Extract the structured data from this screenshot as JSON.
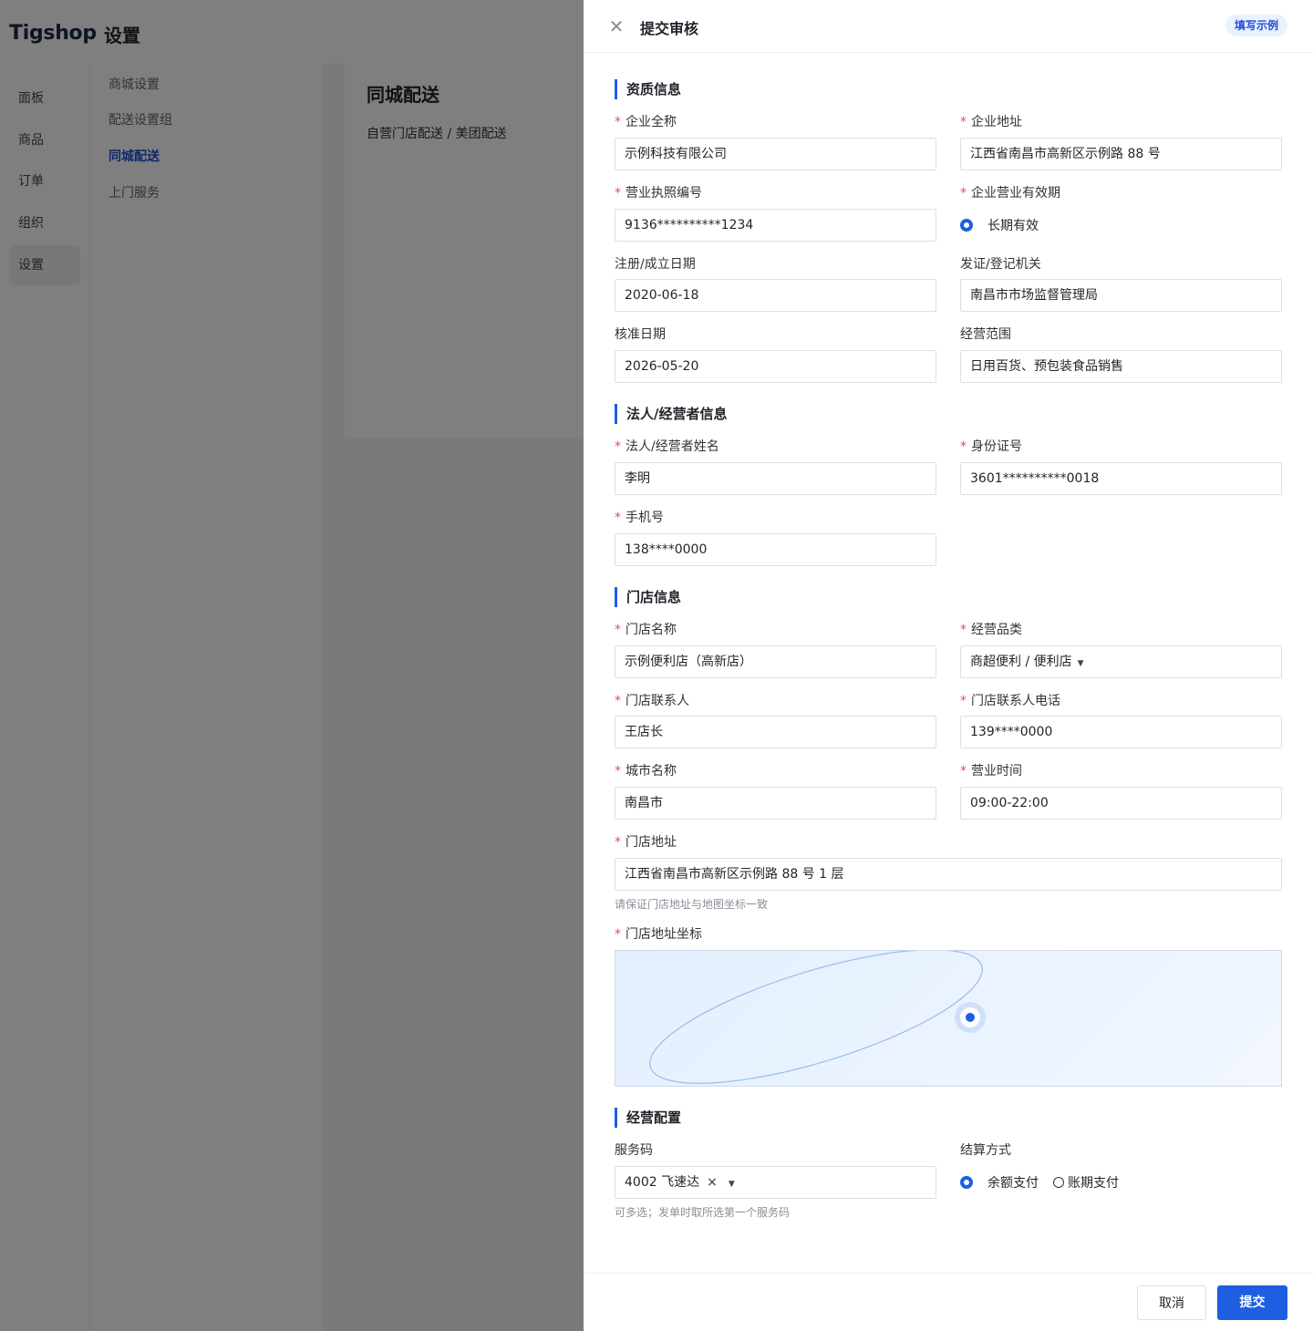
{
  "app": {
    "logo": "Tigshop",
    "title": "设置",
    "nav": [
      "面板",
      "商品",
      "订单",
      "组织",
      "设置"
    ],
    "subnav": [
      "商城设置",
      "配送设置组",
      "同城配送",
      "上门服务"
    ],
    "content_title": "同城配送",
    "content_subtitle": "自营门店配送 / 美团配送"
  },
  "drawer": {
    "title": "提交审核",
    "example_label": "填写示例",
    "sections": {
      "qualification": "资质信息",
      "legal": "法人/经营者信息",
      "store": "门店信息",
      "business": "经营配置"
    },
    "required_mark": "*",
    "fields": {
      "company_name": {
        "label": "企业全称",
        "value": "示例科技有限公司"
      },
      "company_address": {
        "label": "企业地址",
        "value": "江西省南昌市高新区示例路 88 号"
      },
      "license_no": {
        "label": "营业执照编号",
        "value": "9136**********1234"
      },
      "validity": {
        "label": "企业营业有效期",
        "option": "长期有效"
      },
      "reg_date": {
        "label": "注册/成立日期",
        "value": "2020-06-18"
      },
      "issuer": {
        "label": "发证/登记机关",
        "value": "南昌市市场监督管理局"
      },
      "approve_date": {
        "label": "核准日期",
        "value": "2026-05-20"
      },
      "scope": {
        "label": "经营范围",
        "value": "日用百货、预包装食品销售"
      },
      "legal_name": {
        "label": "法人/经营者姓名",
        "value": "李明"
      },
      "id_no": {
        "label": "身份证号",
        "value": "3601**********0018"
      },
      "phone": {
        "label": "手机号",
        "value": "138****0000"
      },
      "store_name": {
        "label": "门店名称",
        "value": "示例便利店（高新店）"
      },
      "category": {
        "label": "经营品类",
        "value": "商超便利 / 便利店"
      },
      "contact": {
        "label": "门店联系人",
        "value": "王店长"
      },
      "contact_phone": {
        "label": "门店联系人电话",
        "value": "139****0000"
      },
      "city": {
        "label": "城市名称",
        "value": "南昌市"
      },
      "hours": {
        "label": "营业时间",
        "value": "09:00-22:00"
      },
      "store_address": {
        "label": "门店地址",
        "value": "江西省南昌市高新区示例路 88 号 1 层",
        "hint": "请保证门店地址与地图坐标一致"
      },
      "coords": {
        "label": "门店地址坐标"
      },
      "service_code": {
        "label": "服务码",
        "value": "4002 飞速达",
        "remove": "×",
        "hint": "可多选；发单时取所选第一个服务码"
      },
      "settlement": {
        "label": "结算方式",
        "options": [
          "余额支付",
          "账期支付"
        ],
        "selected": "余额支付"
      }
    },
    "buttons": {
      "cancel": "取消",
      "submit": "提交"
    }
  },
  "colors": {
    "accent": "#1d5fe0",
    "required": "#e34d59",
    "mask": "rgba(0,0,0,0.5)"
  },
  "icons": {
    "close": "close-icon",
    "dropdown": "chevron-down-icon",
    "map_pin": "map-pin-icon"
  }
}
